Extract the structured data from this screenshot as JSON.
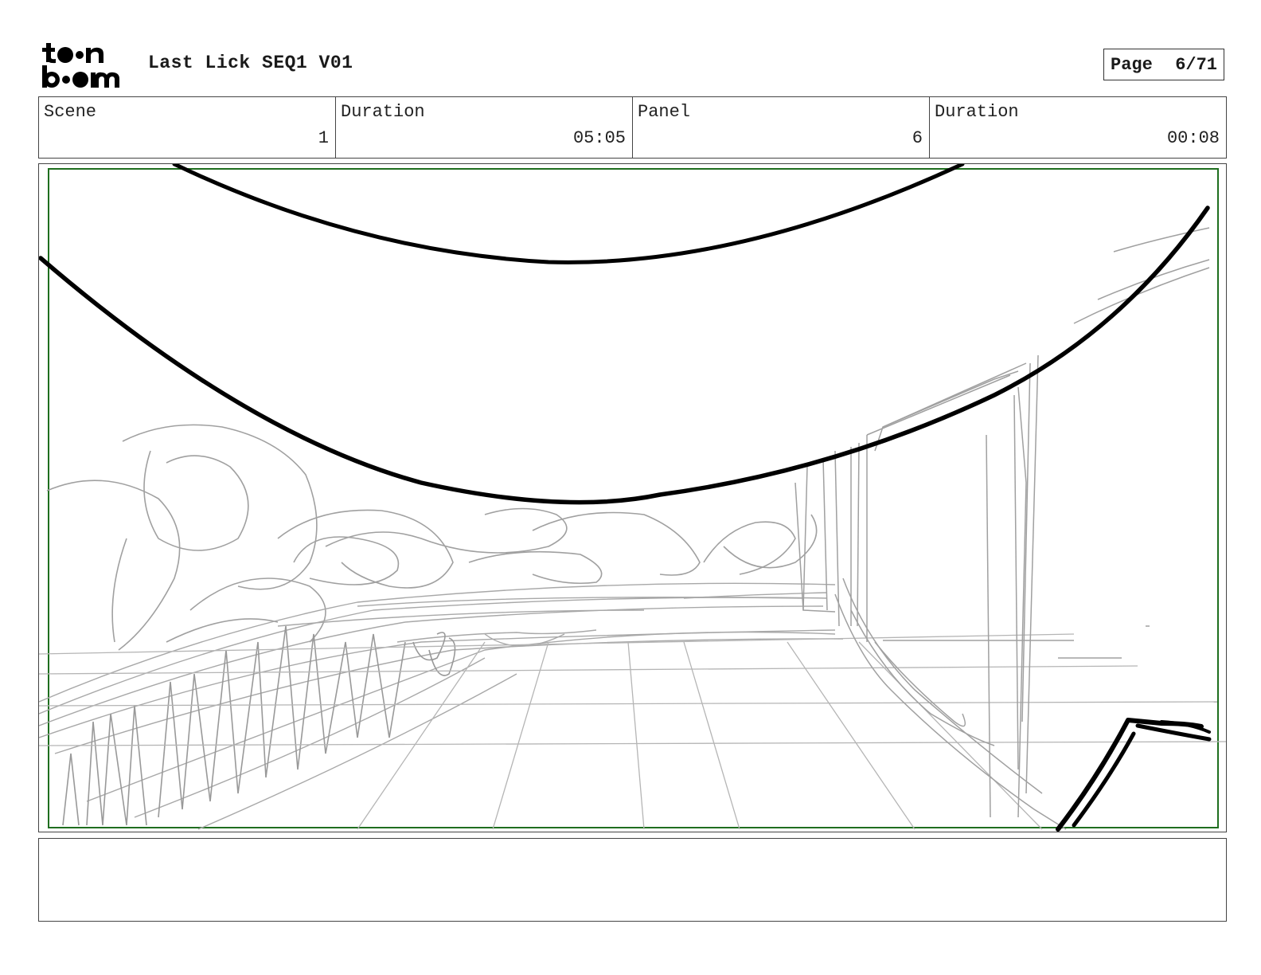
{
  "header": {
    "logo_text": "toon boom",
    "title": "Last Lick SEQ1 V01",
    "page_label": "Page",
    "page_value": "6/71"
  },
  "info": {
    "scene_label": "Scene",
    "scene_value": "1",
    "scene_duration_label": "Duration",
    "scene_duration_value": "05:05",
    "panel_label": "Panel",
    "panel_value": "6",
    "panel_duration_label": "Duration",
    "panel_duration_value": "00:08"
  },
  "colors": {
    "safe_frame": "#1f6e1f",
    "ink": "#000000",
    "sketch": "#9a9a9a"
  },
  "notes": {
    "text": ""
  }
}
